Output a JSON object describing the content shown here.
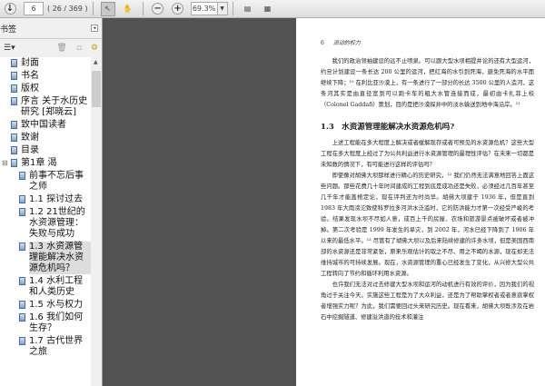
{
  "toolbar": {
    "page_input": "6",
    "page_count": "( 26 / 369 )",
    "zoom": "69.3%"
  },
  "sidebar": {
    "title": "书签",
    "items": [
      {
        "label": "封面"
      },
      {
        "label": "书名"
      },
      {
        "label": "版权"
      },
      {
        "label": "序言 关于水历史研究 [郑晓云]"
      },
      {
        "label": "致中国读者"
      },
      {
        "label": "致谢"
      },
      {
        "label": "目录"
      },
      {
        "label": "第1章 渴"
      },
      {
        "label": "前事不忘后事之师"
      },
      {
        "label": "1.1 探讨过去"
      },
      {
        "label": "1.2 21世纪的水资源管理：失败与成功"
      },
      {
        "label": "1.3 水资源管理能解决水资源危机吗？"
      },
      {
        "label": "1.4 水利工程和人类历史"
      },
      {
        "label": "1.5 水与权力"
      },
      {
        "label": "1.6 我们如何生存？"
      },
      {
        "label": "1.7 古代世界之旅"
      }
    ]
  },
  "document": {
    "page_number": "6",
    "running_title": "流动的权力",
    "para1": "我们的政治领袖建设的远不止喷泉。可以跟大型水坝相提并论的还有大型运河，约旦计划建设一条长达 200 公里的运河，把红海的水引到死海，避免死海的水平面继续下降；¹⁰ 在利比亚沙漠上，有一条进行了一部分的长达 3500 公里的人造河，这条河其实是由直径宽到可以跑卡车的粗大水管连接而成，最初由卡扎菲上校（Colonel Gaddafi）策划，目的是把沙漠探井中的淡水输送到地中海沿岸。¹¹",
    "heading": "1.3　水资源管理能解决水资源危机吗?",
    "para2": "上述工程能在多大程度上解决或者缓解现存或者可预见的水资源危机？这些大型工程在多大程度上经过了为公共利益进行水资源管理的最理性评估？在未来一切都是未知数的情况下，有可能进行这样的评估吗？",
    "para3": "即使像对胡佛大坝那样进行精心的历史研究，¹² 我们仍然无法满意地回答上面这些问题。那些花费几十年时间建成的工程到底是成功还是失败，必须经过几百年甚至几千年才能盖棺定论，现在评判还为时尚早。胡佛大坝建于 1936 年，但是直到 1983 年大雨滂沱致使科罗拉多河洪水泛滥时，它的防洪能力才第一次经受严峻的考验。结果发现水坝不尽如人意，成百上千的房屋、农场和旅游景点被破坏或者被冲掉。第二次考验是 1999 年发生的旱灾，到 2002 年，河水已经下降到了 1906 年以来的最低水平。¹³ 尽管有了胡佛大坝以及后来陆续修建的许多水坝，但是美国西南部的水资源还是非常紧张，原来乐观估计的取之不尽、用之不竭的水源，现在却无法维持城市的可持续发展。现在，水资源管理的重心已经发生了变化，从兴修大型公共工程转向了节约和循环利用水资源。",
    "para4": "也许我们无法对过去修建大型水坝和运河的动机进行有效的评价，因为我们的视角过于关注今天。实施这些工程是为了大众利益，还是为了帮助掌权者或者意欲掌权者增强实力呢？为此，我们需要回过头来研究历史。现在看来，胡佛大坝既涉及在岩石中挖掘隧道、修建溢洪道的技术和灌注"
  }
}
